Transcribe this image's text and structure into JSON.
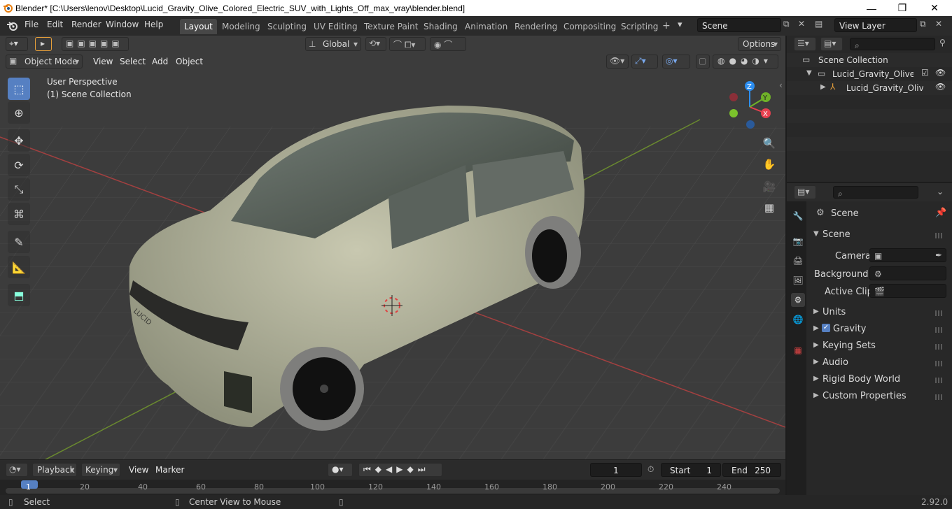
{
  "window": {
    "title": "Blender* [C:\\Users\\lenov\\Desktop\\Lucid_Gravity_Olive_Colored_Electric_SUV_with_Lights_Off_max_vray\\blender.blend]",
    "minimize": "—",
    "maximize": "❐",
    "close": "✕"
  },
  "menu": {
    "file": "File",
    "edit": "Edit",
    "render": "Render",
    "window": "Window",
    "help": "Help"
  },
  "workspaces": [
    "Layout",
    "Modeling",
    "Sculpting",
    "UV Editing",
    "Texture Paint",
    "Shading",
    "Animation",
    "Rendering",
    "Compositing",
    "Scripting"
  ],
  "scene_field": "Scene",
  "view_layer_field": "View Layer",
  "viewport": {
    "transform_orientation": "Global",
    "options_label": "Options",
    "mode": "Object Mode",
    "view_menu": "View",
    "select_menu": "Select",
    "add_menu": "Add",
    "object_menu": "Object",
    "perspective_label": "User Perspective",
    "collection_label": "(1) Scene Collection",
    "gizmo": {
      "x": "X",
      "y": "Y",
      "z": "Z"
    },
    "car_badge": "LUCID"
  },
  "outliner": {
    "root": "Scene Collection",
    "collection": "Lucid_Gravity_Olive_Col",
    "object": "Lucid_Gravity_Olive_"
  },
  "properties": {
    "header": "Scene",
    "panel_scene": "Scene",
    "camera_label": "Camera",
    "background_label": "Background ...",
    "active_clip_label": "Active Clip",
    "panels": [
      "Units",
      "Gravity",
      "Keying Sets",
      "Audio",
      "Rigid Body World",
      "Custom Properties"
    ],
    "gravity_checked": true
  },
  "timeline": {
    "playback": "Playback",
    "keying": "Keying",
    "view": "View",
    "marker": "Marker",
    "current_frame": "1",
    "start_label": "Start",
    "start_value": "1",
    "end_label": "End",
    "end_value": "250",
    "ruler": [
      "1",
      "20",
      "40",
      "60",
      "80",
      "100",
      "120",
      "140",
      "160",
      "180",
      "200",
      "220",
      "240"
    ]
  },
  "status": {
    "select": "Select",
    "center_view": "Center View to Mouse",
    "version": "2.92.0"
  },
  "colors": {
    "accent": "#5680c2",
    "header_bg": "#2b2b2b",
    "viewport_bg": "#3c3c3c",
    "axis_x": "#e8404f",
    "axis_y": "#6fb228",
    "axis_z": "#2c8ef0",
    "car_body": "#b8b8a0"
  }
}
